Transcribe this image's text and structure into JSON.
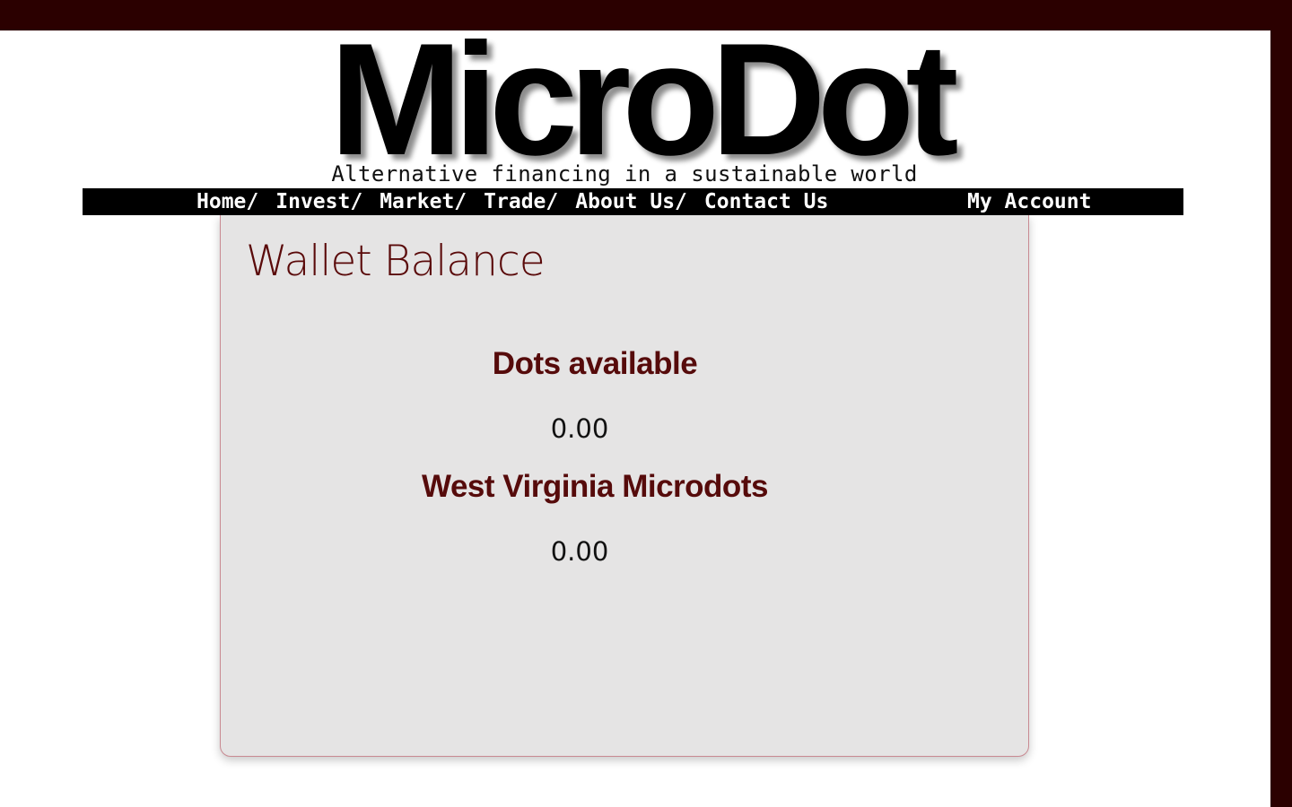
{
  "brand": {
    "logo_text": "MicroDot",
    "tagline": "Alternative financing in a sustainable world"
  },
  "nav": {
    "items": [
      {
        "label": "Home",
        "sep": "/"
      },
      {
        "label": "Invest",
        "sep": "/"
      },
      {
        "label": "Market",
        "sep": "/"
      },
      {
        "label": "Trade",
        "sep": "/"
      },
      {
        "label": "About Us",
        "sep": "/"
      },
      {
        "label": "Contact Us",
        "sep": ""
      }
    ],
    "account_label": "My Account"
  },
  "wallet": {
    "title": "Wallet Balance",
    "sections": [
      {
        "heading": "Dots available",
        "value": "0.00"
      },
      {
        "heading": "West Virginia Microdots",
        "value": "0.00"
      }
    ]
  },
  "colors": {
    "frame": "#2b0000",
    "heading_red": "#560b0b",
    "card_bg": "#e5e4e4",
    "card_border": "#c98a92"
  }
}
